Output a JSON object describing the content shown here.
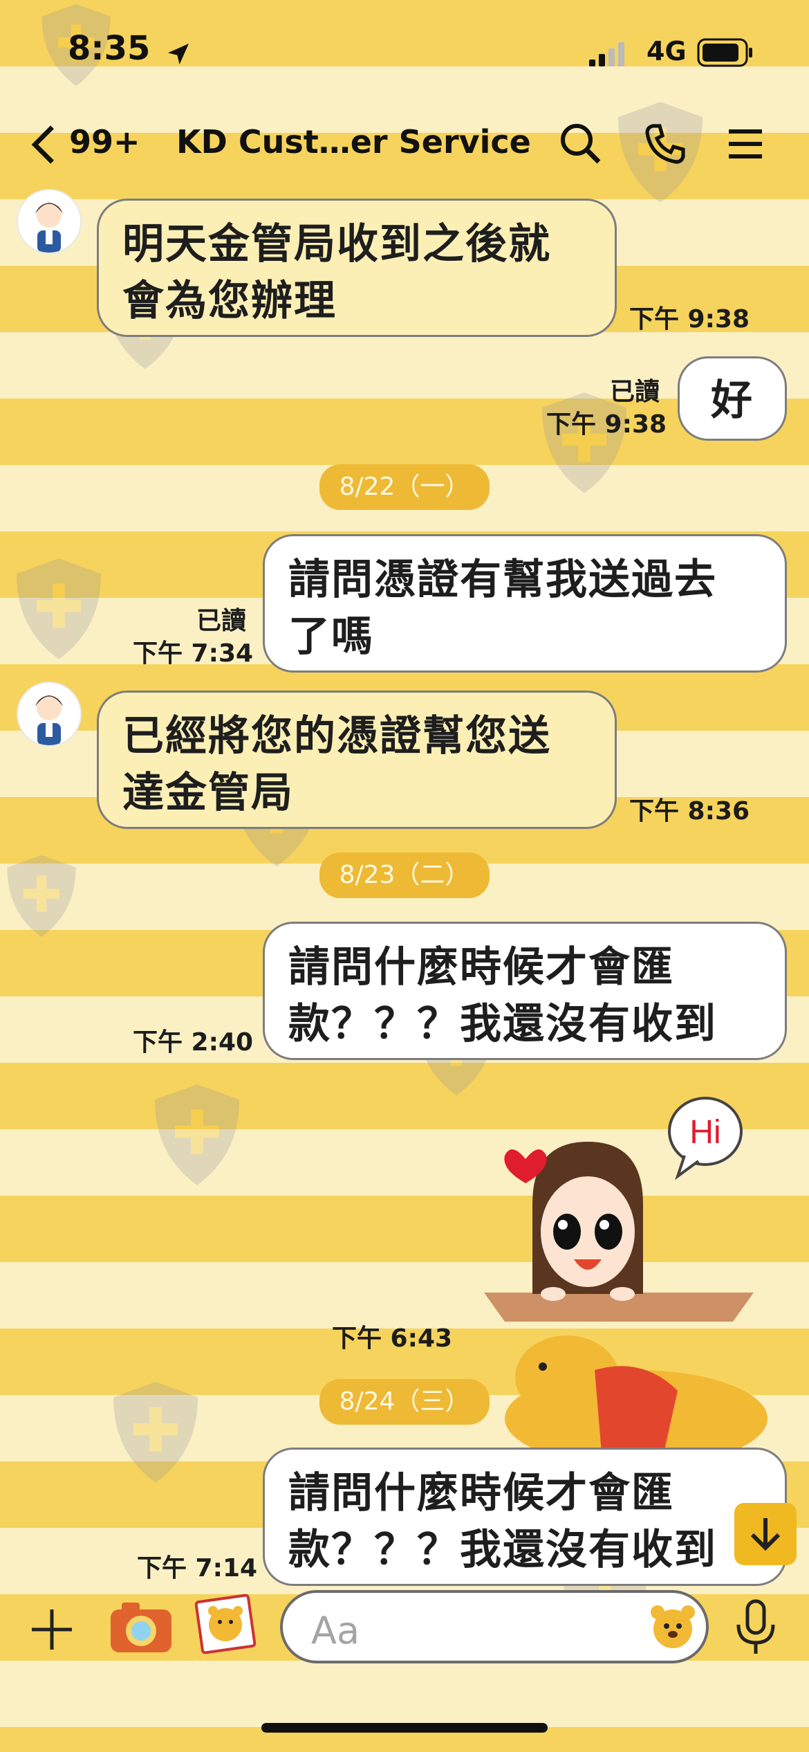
{
  "status_bar": {
    "time": "8:35",
    "network": "4G"
  },
  "header": {
    "unread_badge": "99+",
    "title": "KD Cust…er Service"
  },
  "messages": [
    {
      "side": "in",
      "lines": [
        "明天金管局收到之後就",
        "會為您辦理"
      ],
      "time": "下午 9:38"
    },
    {
      "side": "out",
      "lines": [
        "好"
      ],
      "read": "已讀",
      "time": "下午 9:38"
    },
    {
      "date": "8/22（一）"
    },
    {
      "side": "out",
      "lines": [
        "請問憑證有幫我送過去",
        "了嗎"
      ],
      "read": "已讀",
      "time": "下午 7:34"
    },
    {
      "side": "in",
      "lines": [
        "已經將您的憑證幫您送",
        "達金管局"
      ],
      "time": "下午 8:36"
    },
    {
      "date": "8/23（二）"
    },
    {
      "side": "out",
      "lines": [
        "請問什麼時候才會匯",
        "款？？？我還沒有收到"
      ],
      "time": "下午 2:40"
    },
    {
      "side": "in",
      "sticker": "Hi",
      "time": "下午 6:43"
    },
    {
      "date": "8/24（三）"
    },
    {
      "side": "out",
      "lines": [
        "請問什麼時候才會匯",
        "款？？？我還沒有收到"
      ],
      "time": "下午 7:14"
    }
  ],
  "input": {
    "placeholder": "Aa"
  },
  "icons": [
    "location-arrow-icon",
    "signal-icon",
    "battery-icon",
    "back-chevron-icon",
    "search-icon",
    "phone-icon",
    "menu-icon",
    "plus-icon",
    "camera-icon",
    "photo-icon",
    "emoji-icon",
    "microphone-icon",
    "scroll-down-icon"
  ],
  "colors": {
    "stripe_dark": "#f6d35c",
    "stripe_light": "#fbf0c4",
    "incoming_bubble": "#fbefb6",
    "outgoing_bubble": "#ffffff",
    "date_pill": "#eeb935",
    "accent": "#f0b921"
  }
}
